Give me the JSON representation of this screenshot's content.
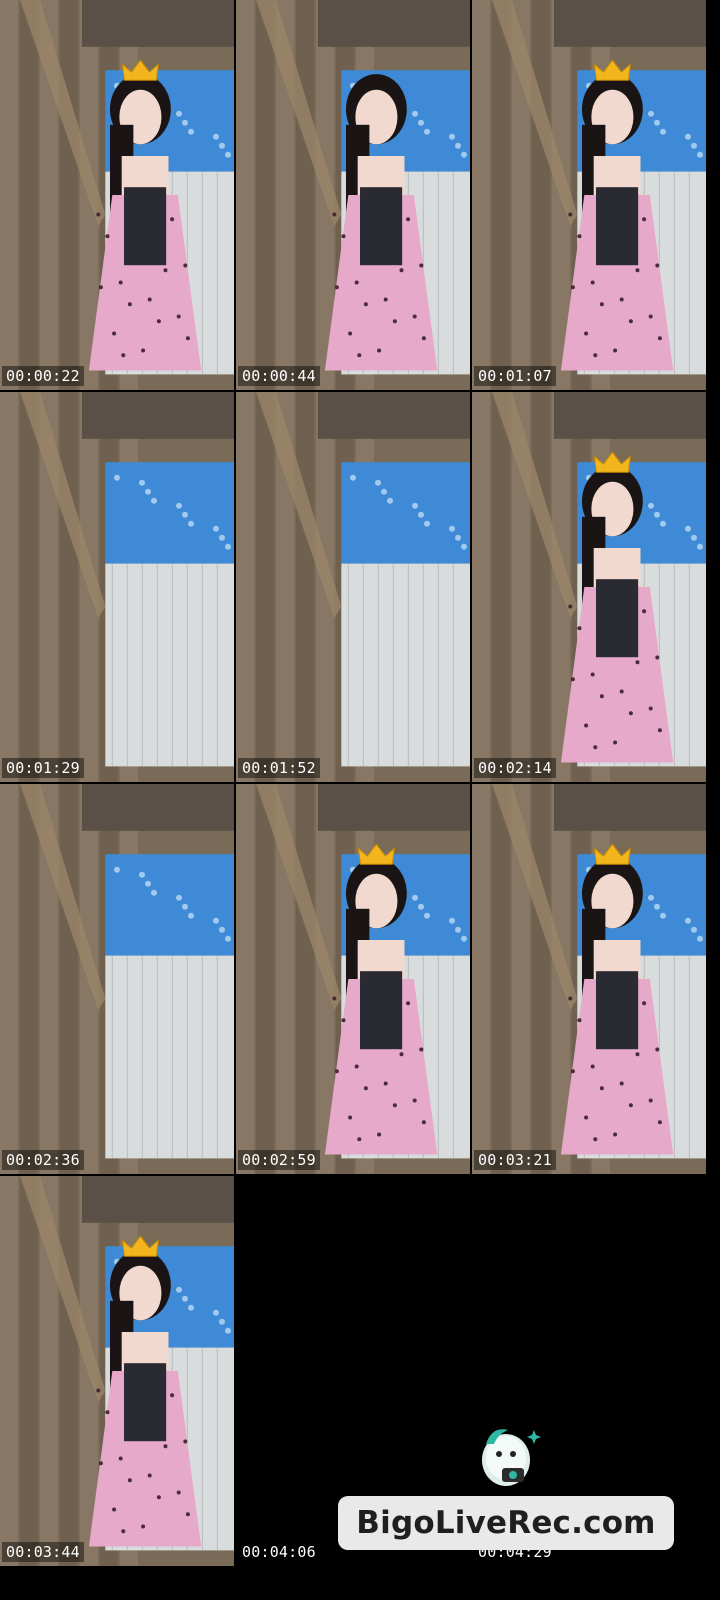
{
  "thumbnails": [
    {
      "time": "00:00:22",
      "scene": "portrait-crown"
    },
    {
      "time": "00:00:44",
      "scene": "dance"
    },
    {
      "time": "00:01:07",
      "scene": "dance-crown"
    },
    {
      "time": "00:01:29",
      "scene": "empty-room"
    },
    {
      "time": "00:01:52",
      "scene": "empty-room"
    },
    {
      "time": "00:02:14",
      "scene": "dance-crown"
    },
    {
      "time": "00:02:36",
      "scene": "empty-room"
    },
    {
      "time": "00:02:59",
      "scene": "portrait-crown"
    },
    {
      "time": "00:03:21",
      "scene": "dance-crown"
    },
    {
      "time": "00:03:44",
      "scene": "dance-crown"
    },
    {
      "time": "00:04:06",
      "scene": "black"
    },
    {
      "time": "00:04:29",
      "scene": "black"
    }
  ],
  "logo": {
    "text_main": "BigoLive",
    "text_rec": "Rec.com",
    "mascot_icon": "bigo-mascot-icon"
  },
  "colors": {
    "background": "#000000",
    "timestamp_text": "#ffffff",
    "logo_box": "#e9e9e9"
  }
}
